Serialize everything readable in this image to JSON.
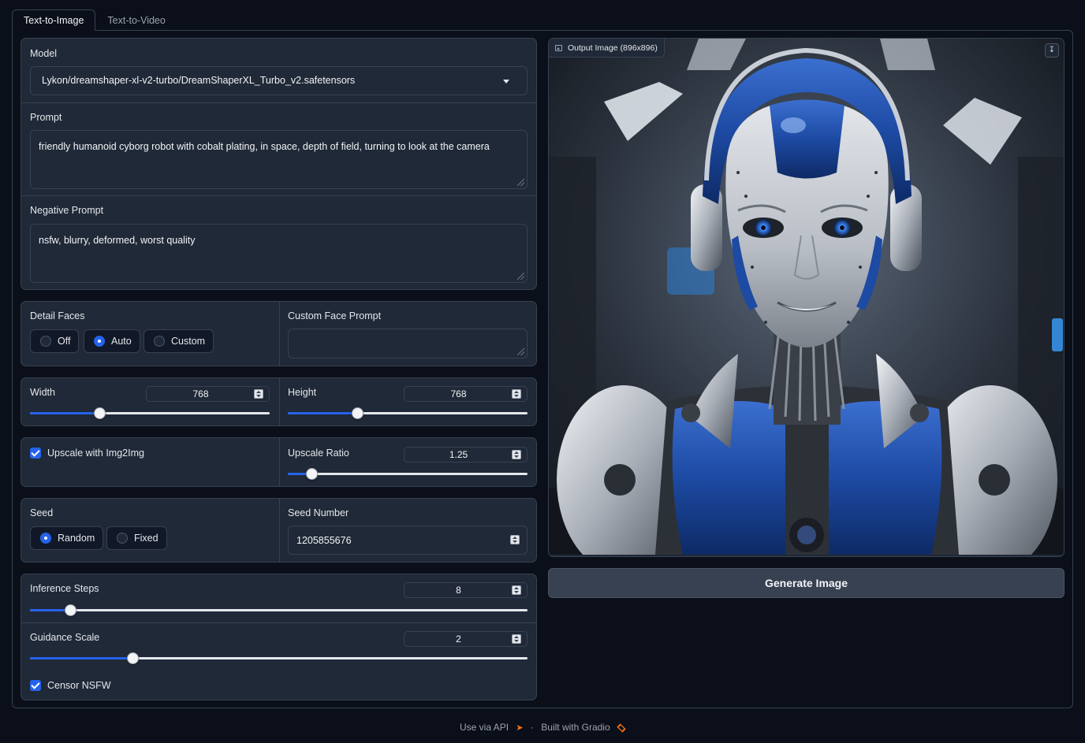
{
  "tabs": [
    "Text-to-Image",
    "Text-to-Video"
  ],
  "model": {
    "label": "Model",
    "value": "Lykon/dreamshaper-xl-v2-turbo/DreamShaperXL_Turbo_v2.safetensors"
  },
  "prompt": {
    "label": "Prompt",
    "value": "friendly humanoid cyborg robot with cobalt plating, in space, depth of field, turning to look at the camera"
  },
  "negative_prompt": {
    "label": "Negative Prompt",
    "value": "nsfw, blurry, deformed, worst quality"
  },
  "detail_faces": {
    "label": "Detail Faces",
    "options": [
      "Off",
      "Auto",
      "Custom"
    ],
    "selected": "Auto"
  },
  "custom_face_prompt": {
    "label": "Custom Face Prompt",
    "value": ""
  },
  "width": {
    "label": "Width",
    "value": "768",
    "fraction": 0.29
  },
  "height": {
    "label": "Height",
    "value": "768",
    "fraction": 0.29
  },
  "upscale": {
    "label": "Upscale with Img2Img",
    "checked": true
  },
  "upscale_ratio": {
    "label": "Upscale Ratio",
    "value": "1.25",
    "fraction": 0.1
  },
  "seed": {
    "label": "Seed",
    "options": [
      "Random",
      "Fixed"
    ],
    "selected": "Random"
  },
  "seed_number": {
    "label": "Seed Number",
    "value": "1205855676"
  },
  "inference_steps": {
    "label": "Inference Steps",
    "value": "8",
    "fraction": 0.081
  },
  "guidance_scale": {
    "label": "Guidance Scale",
    "value": "2",
    "fraction": 0.206
  },
  "censor": {
    "label": "Censor NSFW",
    "checked": true
  },
  "output": {
    "label": "Output Image (896x896)"
  },
  "generate_label": "Generate Image",
  "footer": {
    "api": "Use via API",
    "sep": "·",
    "built": "Built with Gradio"
  },
  "colors": {
    "accent": "#2563eb",
    "panel": "#1f2937",
    "background": "#0b0f19",
    "border": "#374151"
  },
  "icons": [
    "image-icon",
    "download-icon",
    "chevron-down-icon",
    "rocket-icon",
    "gradio-logo-icon"
  ]
}
